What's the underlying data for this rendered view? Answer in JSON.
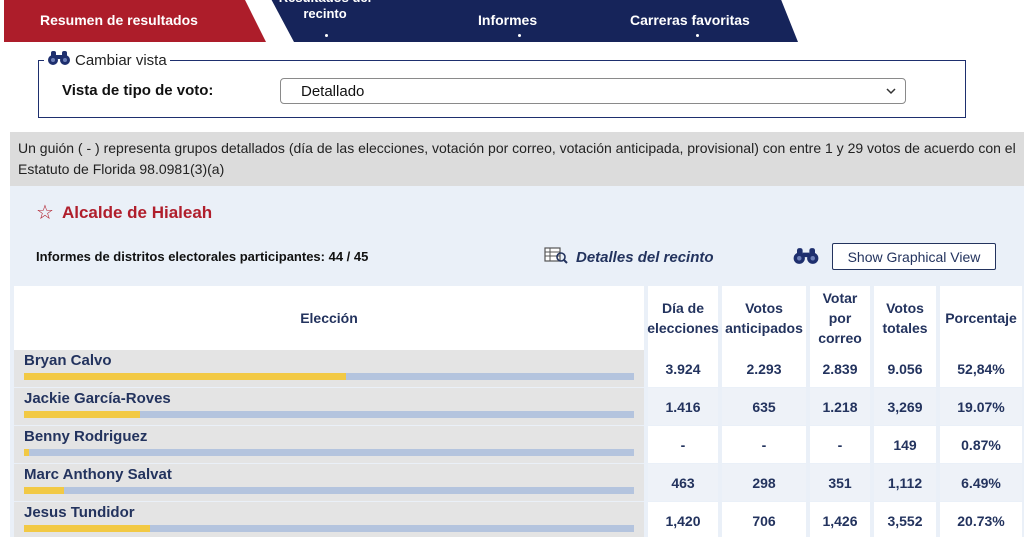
{
  "tabs": {
    "resumen": "Resumen de resultados",
    "recinto": "Resultados del\nrecinto",
    "informes": "Informes",
    "favoritas": "Carreras favoritas"
  },
  "vista": {
    "legend": "Cambiar vista",
    "label": "Vista de tipo de voto:",
    "selected": "Detallado"
  },
  "note": "Un guión ( - ) representa grupos detallados (día de las elecciones, votación por correo, votación anticipada, provisional) con entre 1 y 29 votos de acuerdo con el Estatuto de Florida 98.0981(3)(a)",
  "race": {
    "title": "Alcalde de Hialeah",
    "informes": "Informes de distritos electorales participantes: 44 / 45",
    "detalles": "Detalles del recinto",
    "graph_button": "Show Graphical View"
  },
  "table": {
    "headers": {
      "eleccion": "Elección",
      "dia": "Día de elecciones",
      "anticipados": "Votos anticipados",
      "correo": "Votar por correo",
      "totales": "Votos totales",
      "porcentaje": "Porcentaje"
    },
    "rows": [
      {
        "name": "Bryan Calvo",
        "dia": "3.924",
        "anticipados": "2.293",
        "correo": "2.839",
        "totales": "9.056",
        "porcentaje": "52,84%",
        "share": 0.5284
      },
      {
        "name": "Jackie García-Roves",
        "dia": "1.416",
        "anticipados": "635",
        "correo": "1.218",
        "totales": "3,269",
        "porcentaje": "19.07%",
        "share": 0.1907
      },
      {
        "name": "Benny Rodriguez",
        "dia": "-",
        "anticipados": "-",
        "correo": "-",
        "totales": "149",
        "porcentaje": "0.87%",
        "share": 0.0087
      },
      {
        "name": "Marc Anthony Salvat",
        "dia": "463",
        "anticipados": "298",
        "correo": "351",
        "totales": "1,112",
        "porcentaje": "6.49%",
        "share": 0.0649
      },
      {
        "name": "Jesus Tundidor",
        "dia": "1,420",
        "anticipados": "706",
        "correo": "1,426",
        "totales": "3,552",
        "porcentaje": "20.73%",
        "share": 0.2073
      }
    ]
  },
  "colors": {
    "brand_red": "#b01e2c",
    "brand_navy": "#16245a",
    "bar_fill": "#f2c944",
    "bar_bg": "#b4c4de"
  },
  "icons": [
    "binoculars-icon",
    "star-icon",
    "precinct-details-icon",
    "chevron-down-icon"
  ]
}
